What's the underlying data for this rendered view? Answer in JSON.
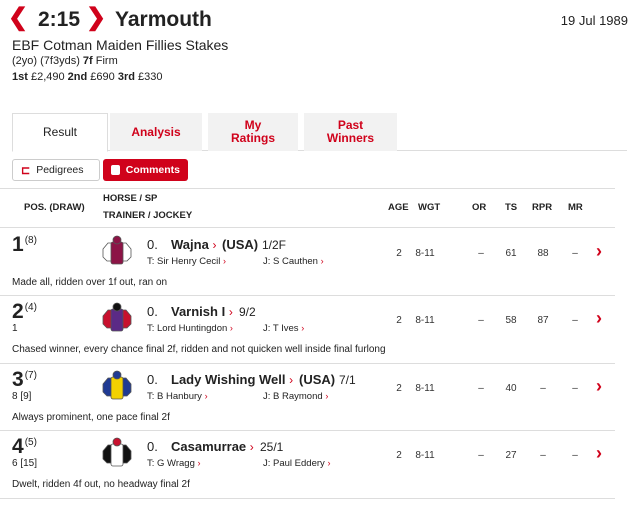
{
  "race": {
    "time": "2:15",
    "course": "Yarmouth",
    "date": "19 Jul 1989",
    "name": "EBF Cotman Maiden Fillies Stakes",
    "conditions_pre": "(2yo) (7f3yds) ",
    "distance": "7f",
    "going": " Firm",
    "prizes": [
      {
        "place": "1st",
        "amount": " £2,490 "
      },
      {
        "place": "2nd",
        "amount": " £690 "
      },
      {
        "place": "3rd",
        "amount": " £330"
      }
    ]
  },
  "nav": {
    "prev_icon": "chevron-left-icon",
    "next_icon": "chevron-right-icon",
    "prev": "❮",
    "next": "❯"
  },
  "tabs": [
    {
      "label": "Result"
    },
    {
      "label": "Analysis"
    },
    {
      "label": "My Ratings"
    },
    {
      "label": "Past Winners"
    }
  ],
  "buttons": {
    "pedigrees": "Pedigrees",
    "comments": "Comments"
  },
  "columns": {
    "pos": "POS. (DRAW)",
    "horse": "HORSE / SP",
    "trainer": "TRAINER / JOCKEY",
    "age": "AGE",
    "wgt": "WGT",
    "or": "OR",
    "ts": "TS",
    "rpr": "RPR",
    "mr": "MR"
  },
  "runners": [
    {
      "pos": "1",
      "draw": "(8)",
      "beaten": "",
      "num": "0.",
      "name": "Wajna",
      "origin": "(USA)",
      "sp": "1/2F",
      "trainer": "T: Sir Henry Cecil",
      "jockey": "J: S Cauthen",
      "age": "2",
      "wgt": "8-11",
      "or": "–",
      "ts": "61",
      "rpr": "88",
      "mr": "–",
      "comment": "Made all, ridden over 1f out, ran on",
      "silk": {
        "body": "#8c1446",
        "sleeves": "#ffffff",
        "cap": "#8c1446"
      }
    },
    {
      "pos": "2",
      "draw": "(4)",
      "beaten": "1",
      "num": "0.",
      "name": "Varnish I",
      "origin": "",
      "sp": "9/2",
      "trainer": "T: Lord Huntingdon",
      "jockey": "J: T Ives",
      "age": "2",
      "wgt": "8-11",
      "or": "–",
      "ts": "58",
      "rpr": "87",
      "mr": "–",
      "comment": "Chased winner, every chance final 2f, ridden and not quicken well inside final furlong",
      "silk": {
        "body": "#5b2a86",
        "sleeves": "#c8102e",
        "cap": "#111111"
      }
    },
    {
      "pos": "3",
      "draw": "(7)",
      "beaten": "8 [9]",
      "num": "0.",
      "name": "Lady Wishing Well",
      "origin": "(USA)",
      "sp": "7/1",
      "trainer": "T: B Hanbury",
      "jockey": "J: B Raymond",
      "age": "2",
      "wgt": "8-11",
      "or": "–",
      "ts": "40",
      "rpr": "–",
      "mr": "–",
      "comment": "Always prominent, one pace final 2f",
      "silk": {
        "body": "#f2d100",
        "sleeves": "#1f3a93",
        "cap": "#1f3a93"
      }
    },
    {
      "pos": "4",
      "draw": "(5)",
      "beaten": "6 [15]",
      "num": "0.",
      "name": "Casamurrae",
      "origin": "",
      "sp": "25/1",
      "trainer": "T: G Wragg",
      "jockey": "J: Paul Eddery",
      "age": "2",
      "wgt": "8-11",
      "or": "–",
      "ts": "27",
      "rpr": "–",
      "mr": "–",
      "comment": "Dwelt, ridden 4f out, no headway final 2f",
      "silk": {
        "body": "#ffffff",
        "sleeves": "#111111",
        "cap": "#c8102e"
      }
    }
  ]
}
